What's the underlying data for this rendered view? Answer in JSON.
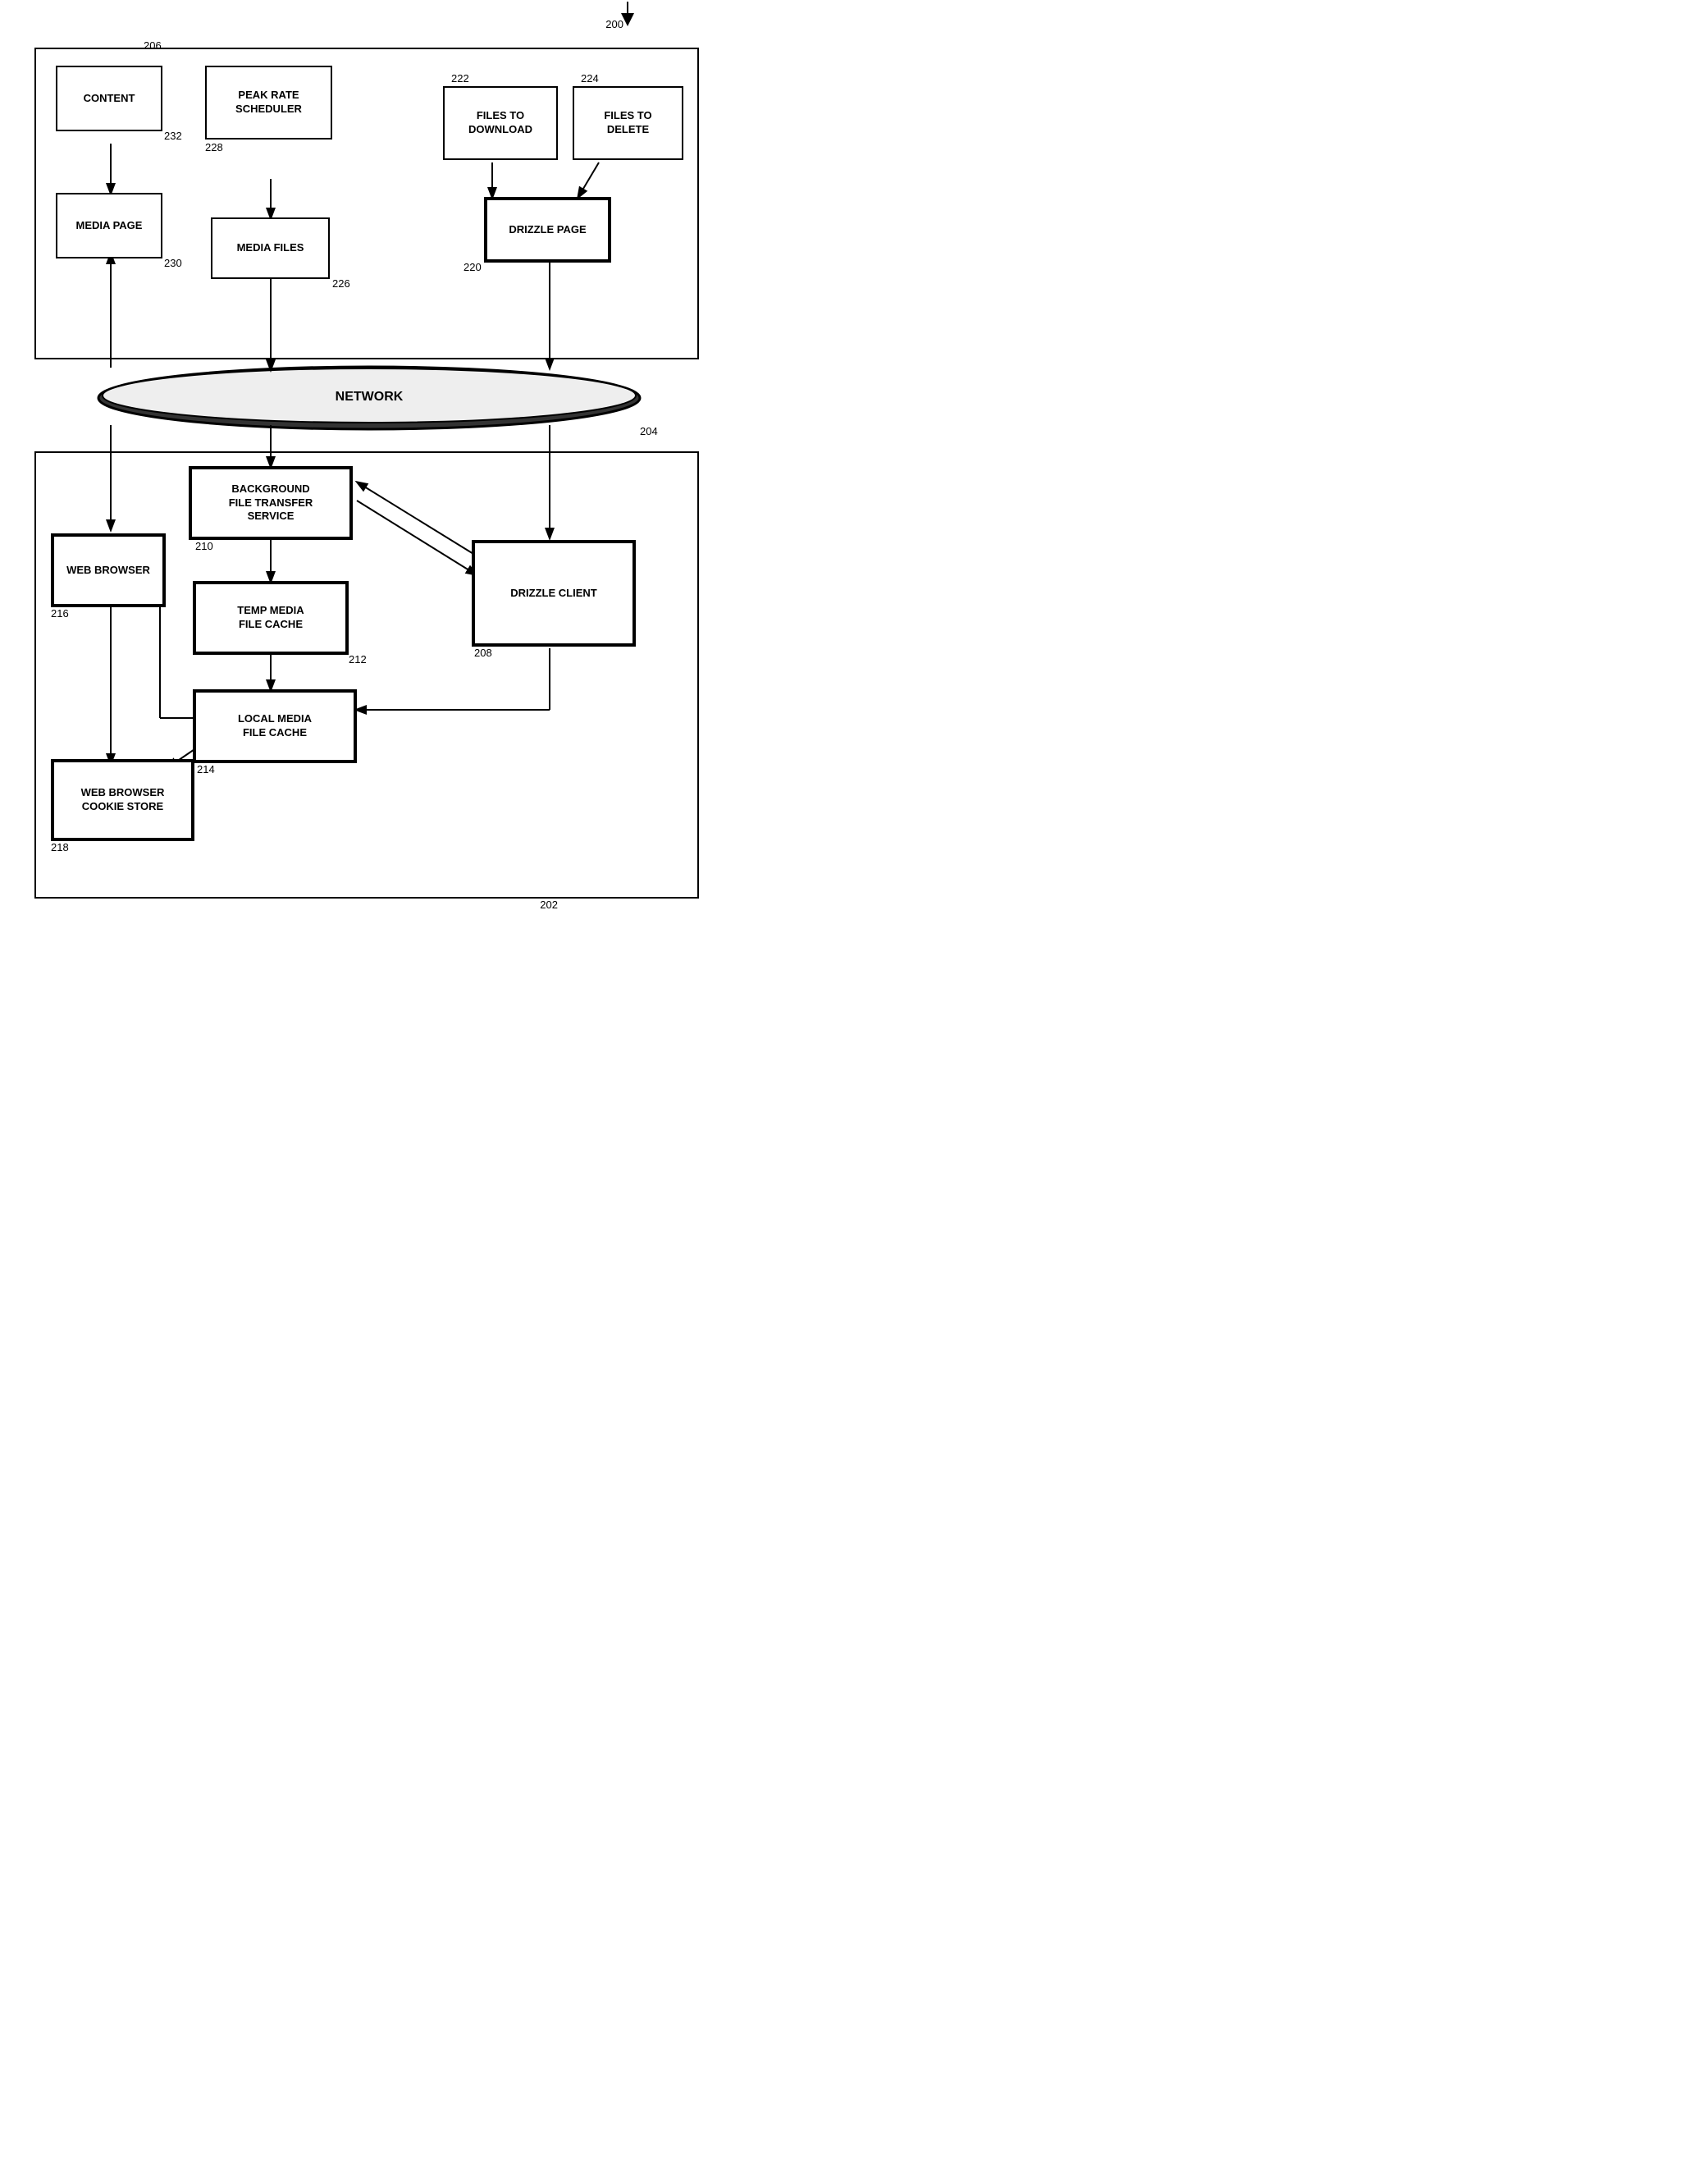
{
  "diagram": {
    "title": "200",
    "regions": {
      "top_label": "206",
      "top_region_label": "200",
      "bottom_label": "202",
      "network_label": "NETWORK",
      "network_ref": "204"
    },
    "boxes": {
      "content": {
        "label": "CONTENT",
        "ref": "232"
      },
      "media_page": {
        "label": "MEDIA PAGE",
        "ref": "230"
      },
      "peak_rate_scheduler": {
        "label": "PEAK RATE\nSCHEDULER",
        "ref": "228"
      },
      "media_files": {
        "label": "MEDIA FILES",
        "ref": "226"
      },
      "files_to_download": {
        "label": "FILES TO\nDOWNLOAD",
        "ref": "222"
      },
      "files_to_delete": {
        "label": "FILES TO\nDELETE",
        "ref": "224"
      },
      "drizzle_page": {
        "label": "DRIZZLE PAGE",
        "ref": "220"
      },
      "background_file_transfer": {
        "label": "BACKGROUND\nFILE TRANSFER\nSERVICE",
        "ref": "210"
      },
      "web_browser": {
        "label": "WEB BROWSER",
        "ref": "216"
      },
      "temp_media_file_cache": {
        "label": "TEMP MEDIA\nFILE CACHE",
        "ref": "212"
      },
      "drizzle_client": {
        "label": "DRIZZLE CLIENT",
        "ref": "208"
      },
      "local_media_file_cache": {
        "label": "LOCAL MEDIA\nFILE CACHE",
        "ref": "214"
      },
      "web_browser_cookie_store": {
        "label": "WEB BROWSER\nCOOKIE STORE",
        "ref": "218"
      }
    }
  }
}
